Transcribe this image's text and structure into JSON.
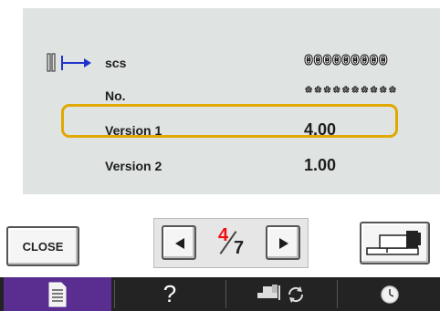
{
  "info": {
    "rows": [
      {
        "label": "scs",
        "value": "000000000"
      },
      {
        "label": "No.",
        "value": "**********"
      },
      {
        "label": "Version 1",
        "value": "4.00"
      },
      {
        "label": "Version 2",
        "value": "1.00"
      }
    ],
    "highlighted_row": "Version 1",
    "highlight_color": "#e0a800"
  },
  "controls": {
    "close_label": "CLOSE",
    "page_current": "4",
    "page_total": "7",
    "page_current_color": "#e11111"
  },
  "nav": {
    "items": [
      {
        "icon": "document-icon",
        "active": true
      },
      {
        "icon": "help-icon",
        "text": "?"
      },
      {
        "icon": "embroidery-switch-icon"
      },
      {
        "icon": "clock-icon"
      }
    ],
    "active_color": "#5a2d91"
  }
}
